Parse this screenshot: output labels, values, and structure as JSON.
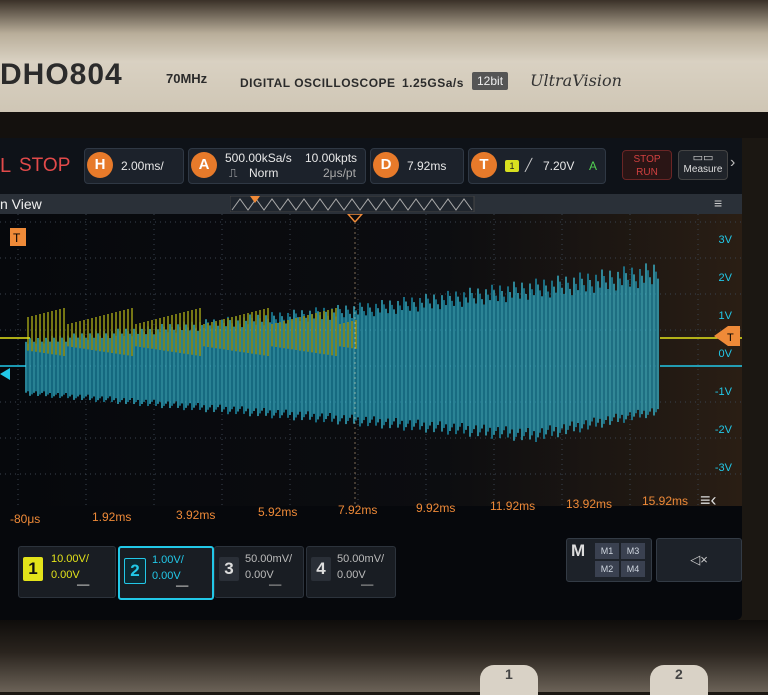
{
  "device": {
    "model": "DHO804",
    "bandwidth": "70MHz",
    "type": "DIGITAL OSCILLOSCOPE",
    "sample_rate": "1.25GSa/s",
    "bits": "12bit",
    "brand": "UltraVision"
  },
  "topbar": {
    "run_prefix": "L",
    "run_state": "STOP",
    "horizontal_icon": "H",
    "timebase": "2.00ms/",
    "acquire_icon": "A",
    "acq_rate": "500.00kSa/s",
    "acq_mode": "Norm",
    "mem_depth": "10.00kpts",
    "time_per_pt": "2μs/pt",
    "delay_icon": "D",
    "delay": "7.92ms",
    "trigger_icon": "T",
    "trigger_source": "1",
    "trigger_level": "7.20V",
    "trigger_type": "A",
    "stop_label": "STOP",
    "run_label": "RUN",
    "measure_label": "Measure"
  },
  "view": {
    "title": "n View"
  },
  "y_labels": [
    "3V",
    "2V",
    "1V",
    "0V",
    "-1V",
    "-2V",
    "-3V"
  ],
  "x_labels": [
    "-80μs",
    "1.92ms",
    "3.92ms",
    "5.92ms",
    "7.92ms",
    "9.92ms",
    "11.92ms",
    "13.92ms",
    "15.92ms"
  ],
  "channels": [
    {
      "num": "1",
      "scale": "10.00V/",
      "offset": "0.00V",
      "color": "#e3e31a"
    },
    {
      "num": "2",
      "scale": "1.00V/",
      "offset": "0.00V",
      "color": "#22c8e8"
    },
    {
      "num": "3",
      "scale": "50.00mV/",
      "offset": "0.00V",
      "color": "#d45ad4"
    },
    {
      "num": "4",
      "scale": "50.00mV/",
      "offset": "0.00V",
      "color": "#3a7ee0"
    }
  ],
  "math": {
    "label": "M",
    "items": [
      "M1",
      "M3",
      "M2",
      "M4"
    ]
  },
  "knobs": [
    "1",
    "2"
  ]
}
